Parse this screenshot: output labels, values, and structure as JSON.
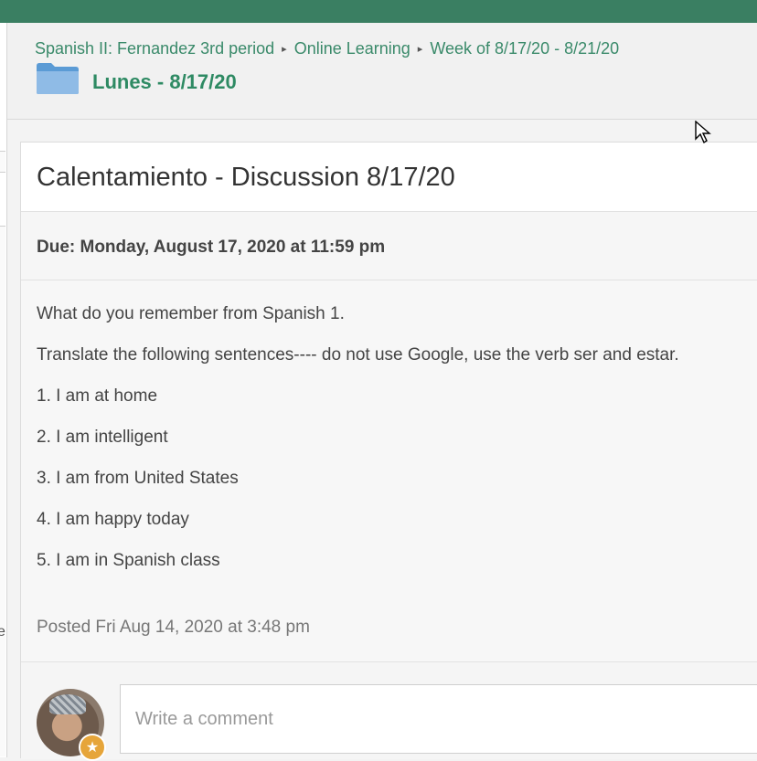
{
  "breadcrumb": {
    "items": [
      "Spanish II: Fernandez 3rd period",
      "Online Learning",
      "Week of 8/17/20 - 8/21/20"
    ],
    "separator": "▸"
  },
  "folder": {
    "title": "Lunes - 8/17/20",
    "icon": "folder-icon",
    "color": "#5b9bd5"
  },
  "assignment": {
    "title": "Calentamiento - Discussion 8/17/20",
    "due": "Due: Monday, August 17, 2020 at 11:59 pm",
    "body": [
      "What do you remember from Spanish 1.",
      "Translate the following sentences---- do not use Google, use the verb ser and estar.",
      "1. I am at home",
      "2. I am intelligent",
      "3. I am from United States",
      "4. I am happy today",
      "5. I am in Spanish class"
    ],
    "posted": "Posted Fri Aug 14, 2020 at 3:48 pm"
  },
  "comment": {
    "placeholder": "Write a comment",
    "badge_icon": "star-icon"
  },
  "left_edge_letter": "e",
  "colors": {
    "accent": "#3a7f62",
    "link": "#3a8a6a",
    "title_green": "#2e8a63",
    "badge": "#e6a53a"
  }
}
